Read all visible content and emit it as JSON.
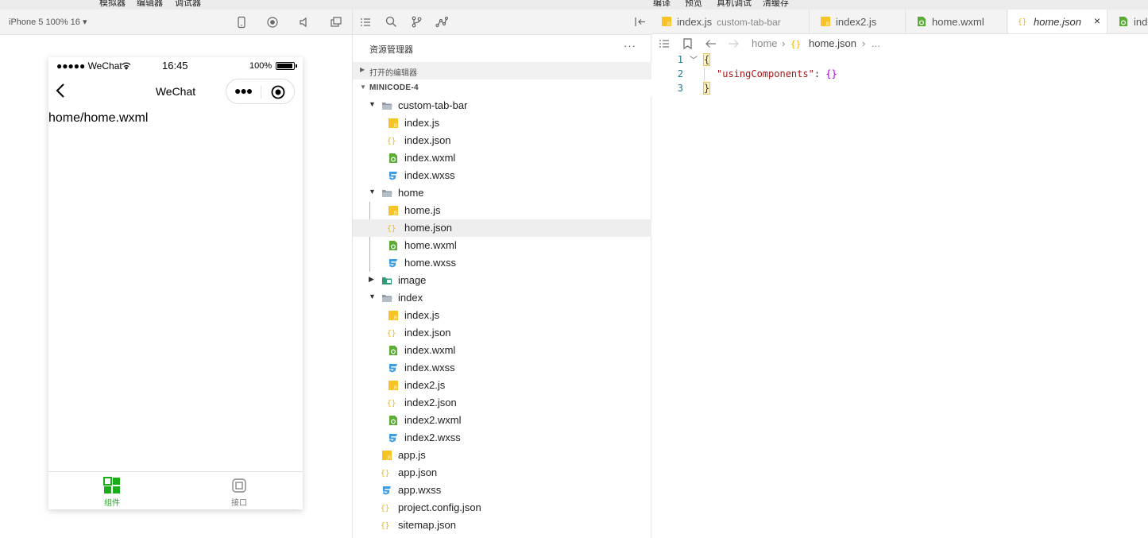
{
  "menu": {
    "items": [
      "模拟器",
      "编辑器",
      "调试器",
      "编译",
      "预览",
      "真机调试",
      "清缓存"
    ]
  },
  "simulator": {
    "device_label": "iPhone 5 100% 16 ▾",
    "status": {
      "carrier": "●●●●● WeChat",
      "time": "16:45",
      "battery": "100%"
    },
    "nav_title": "WeChat",
    "page_text": "home/home.wxml",
    "tabs": [
      {
        "label": "组件",
        "color": "#1aad19"
      },
      {
        "label": "接口",
        "color": "#777777"
      }
    ]
  },
  "explorer": {
    "title": "资源管理器",
    "more": "···",
    "sections": {
      "open_editors": "打开的编辑器",
      "project": "MINICODE-4"
    },
    "tree": {
      "custom_tab_bar": {
        "name": "custom-tab-bar",
        "files": [
          "index.js",
          "index.json",
          "index.wxml",
          "index.wxss"
        ]
      },
      "home": {
        "name": "home",
        "files": [
          "home.js",
          "home.json",
          "home.wxml",
          "home.wxss"
        ]
      },
      "image": {
        "name": "image"
      },
      "index": {
        "name": "index",
        "files": [
          "index.js",
          "index.json",
          "index.wxml",
          "index.wxss",
          "index2.js",
          "index2.json",
          "index2.wxml",
          "index2.wxss"
        ]
      },
      "root_files": [
        "app.js",
        "app.json",
        "app.wxss",
        "project.config.json",
        "sitemap.json"
      ]
    },
    "selected": "home.json"
  },
  "editor": {
    "tabs": [
      {
        "name": "index.js",
        "desc": "custom-tab-bar"
      },
      {
        "name": "index2.js",
        "desc": ""
      },
      {
        "name": "home.wxml",
        "desc": ""
      },
      {
        "name": "home.json",
        "desc": "",
        "close": "×"
      },
      {
        "name": "ind",
        "desc": ""
      }
    ],
    "breadcrumb": {
      "folder": "home",
      "file": "home.json",
      "more": "..."
    },
    "lines": [
      {
        "num": "1",
        "open_brace": "{"
      },
      {
        "num": "2",
        "key": "\"usingComponents\"",
        "colon": ": ",
        "value": "{}"
      },
      {
        "num": "3",
        "close_brace": "}"
      }
    ]
  },
  "colors": {
    "js": "#f7c325",
    "json": "#f0b400",
    "wxml": "#5aad34",
    "wxss": "#3b9ee5",
    "folder": "#8f9aa5",
    "image_folder": "#2f9b74"
  }
}
